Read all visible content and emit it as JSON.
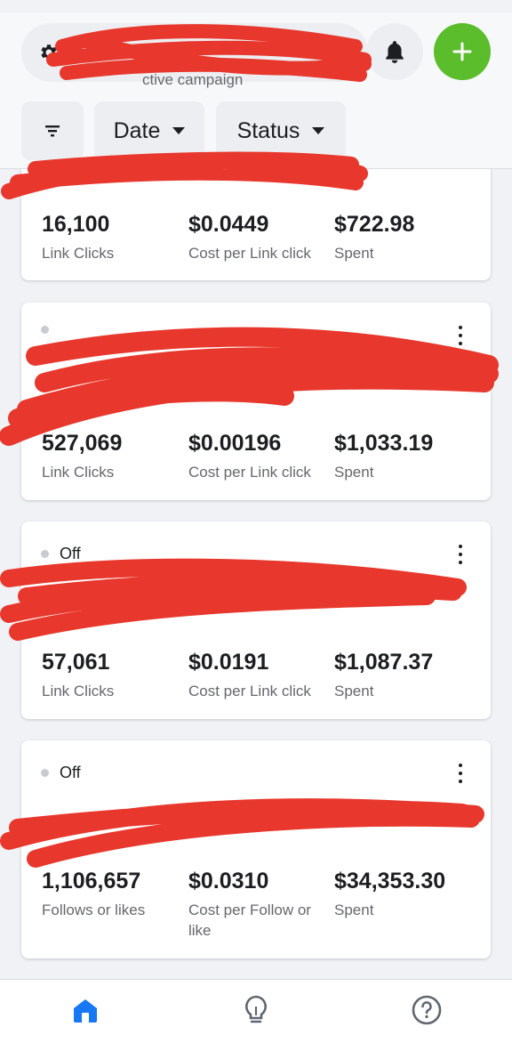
{
  "header": {
    "campaign_subtitle": "ctive campaign",
    "filters": {
      "date_label": "Date",
      "status_label": "Status"
    },
    "icons": {
      "settings": "gear-icon",
      "notifications": "bell-icon",
      "create": "plus-icon",
      "filter": "filter-icon"
    }
  },
  "colors": {
    "create_button": "#5bbd2b",
    "nav_active": "#1877f2",
    "redaction": "#e8372c"
  },
  "cards": [
    {
      "status": "",
      "metrics": [
        {
          "value": "16,100",
          "label": "Link Clicks"
        },
        {
          "value": "$0.0449",
          "label": "Cost per Link click"
        },
        {
          "value": "$722.98",
          "label": "Spent"
        }
      ]
    },
    {
      "status": "",
      "metrics": [
        {
          "value": "527,069",
          "label": "Link Clicks"
        },
        {
          "value": "$0.00196",
          "label": "Cost per Link click"
        },
        {
          "value": "$1,033.19",
          "label": "Spent"
        }
      ]
    },
    {
      "status": "Off",
      "metrics": [
        {
          "value": "57,061",
          "label": "Link Clicks"
        },
        {
          "value": "$0.0191",
          "label": "Cost per Link click"
        },
        {
          "value": "$1,087.37",
          "label": "Spent"
        }
      ]
    },
    {
      "status": "Off",
      "metrics": [
        {
          "value": "1,106,657",
          "label": "Follows or likes"
        },
        {
          "value": "$0.0310",
          "label": "Cost per Follow or like"
        },
        {
          "value": "$34,353.30",
          "label": "Spent"
        }
      ]
    }
  ],
  "bottom_nav": [
    {
      "icon": "home-icon",
      "active": true
    },
    {
      "icon": "lightbulb-icon",
      "active": false
    },
    {
      "icon": "help-icon",
      "active": false
    }
  ]
}
